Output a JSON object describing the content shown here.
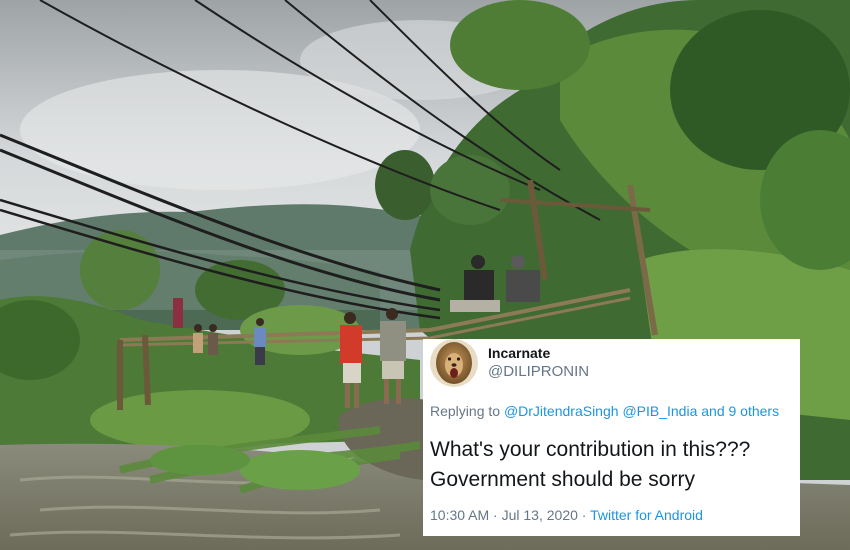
{
  "tweet": {
    "display_name": "Incarnate",
    "handle": "@DILIPRONIN",
    "reply_prefix": "Replying to",
    "reply_mention_1": "@DrJitendraSingh",
    "reply_mention_2": "@PIB_India",
    "reply_suffix": "and 9 others",
    "text_line_1": "What's your contribution in this???",
    "text_line_2": "Government should be sorry",
    "time": "10:30 AM",
    "separator": "·",
    "date": "Jul 13, 2020",
    "source": "Twitter for Android"
  },
  "colors": {
    "link": "#1b95e0",
    "muted": "#657786",
    "text": "#14171a"
  },
  "photo": {
    "subject": "villagers repairing a bamboo bridge over a river in a forest"
  }
}
